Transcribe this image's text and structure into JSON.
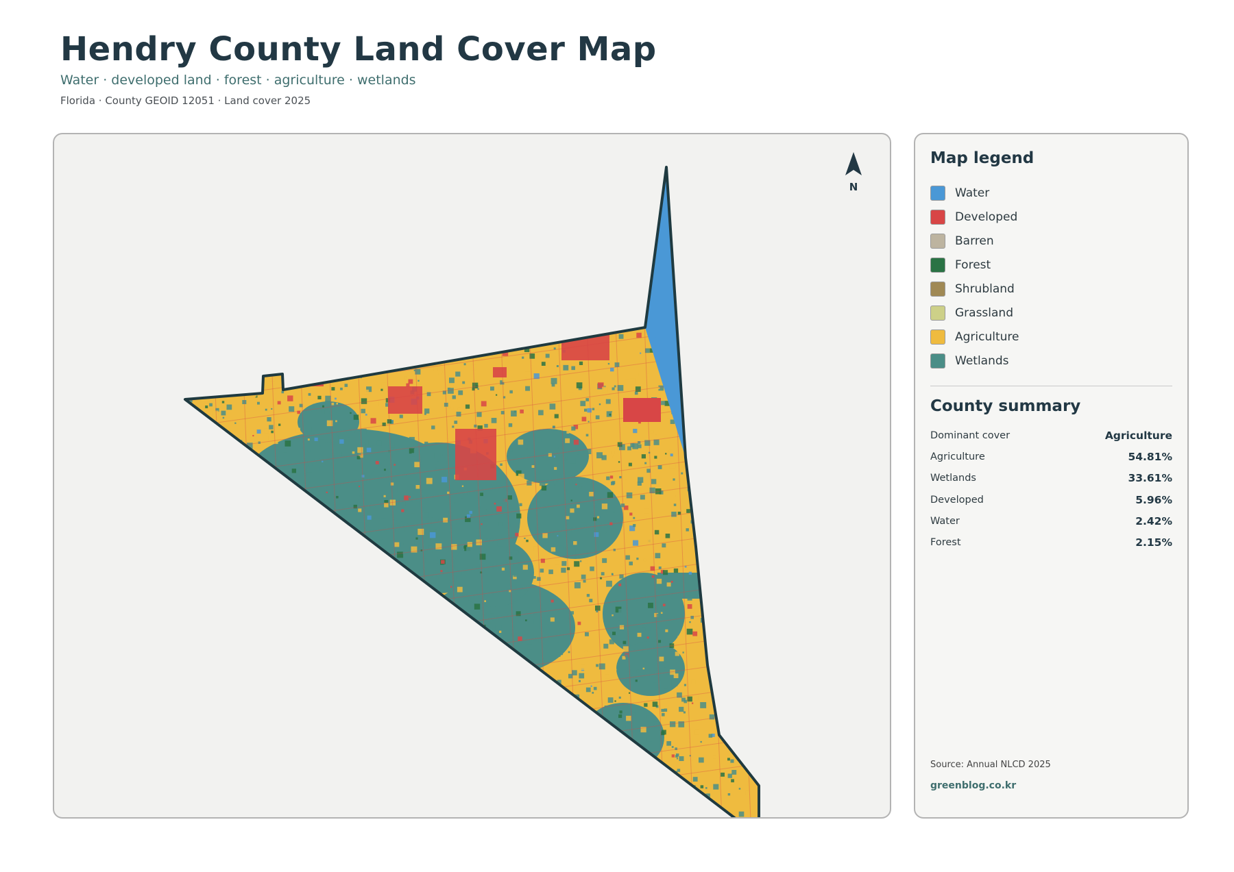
{
  "header": {
    "title": "Hendry County Land Cover Map",
    "subtitle": "Water · developed land · forest · agriculture · wetlands",
    "meta": "Florida · County GEOID 12051 · Land cover 2025"
  },
  "map": {
    "north_label": "N",
    "colors": {
      "water": "#4a98d6",
      "developed": "#d84646",
      "barren": "#bdb4a0",
      "forest": "#2a7344",
      "shrubland": "#a08954",
      "grassland": "#cdd088",
      "agriculture": "#efbb3f",
      "wetlands": "#4b8e87",
      "outline": "#1f3a40",
      "background": "#f2f2f0"
    }
  },
  "legend": {
    "title": "Map legend",
    "items": [
      {
        "label": "Water",
        "color": "#4a98d6"
      },
      {
        "label": "Developed",
        "color": "#d84646"
      },
      {
        "label": "Barren",
        "color": "#bdb4a0"
      },
      {
        "label": "Forest",
        "color": "#2a7344"
      },
      {
        "label": "Shrubland",
        "color": "#a08954"
      },
      {
        "label": "Grassland",
        "color": "#cdd088"
      },
      {
        "label": "Agriculture",
        "color": "#efbb3f"
      },
      {
        "label": "Wetlands",
        "color": "#4b8e87"
      }
    ]
  },
  "summary": {
    "title": "County summary",
    "rows": [
      {
        "label": "Dominant cover",
        "value": "Agriculture"
      },
      {
        "label": "Agriculture",
        "value": "54.81%"
      },
      {
        "label": "Wetlands",
        "value": "33.61%"
      },
      {
        "label": "Developed",
        "value": "5.96%"
      },
      {
        "label": "Water",
        "value": "2.42%"
      },
      {
        "label": "Forest",
        "value": "2.15%"
      }
    ]
  },
  "footer": {
    "source": "Source: Annual NLCD 2025",
    "site": "greenblog.co.kr"
  }
}
